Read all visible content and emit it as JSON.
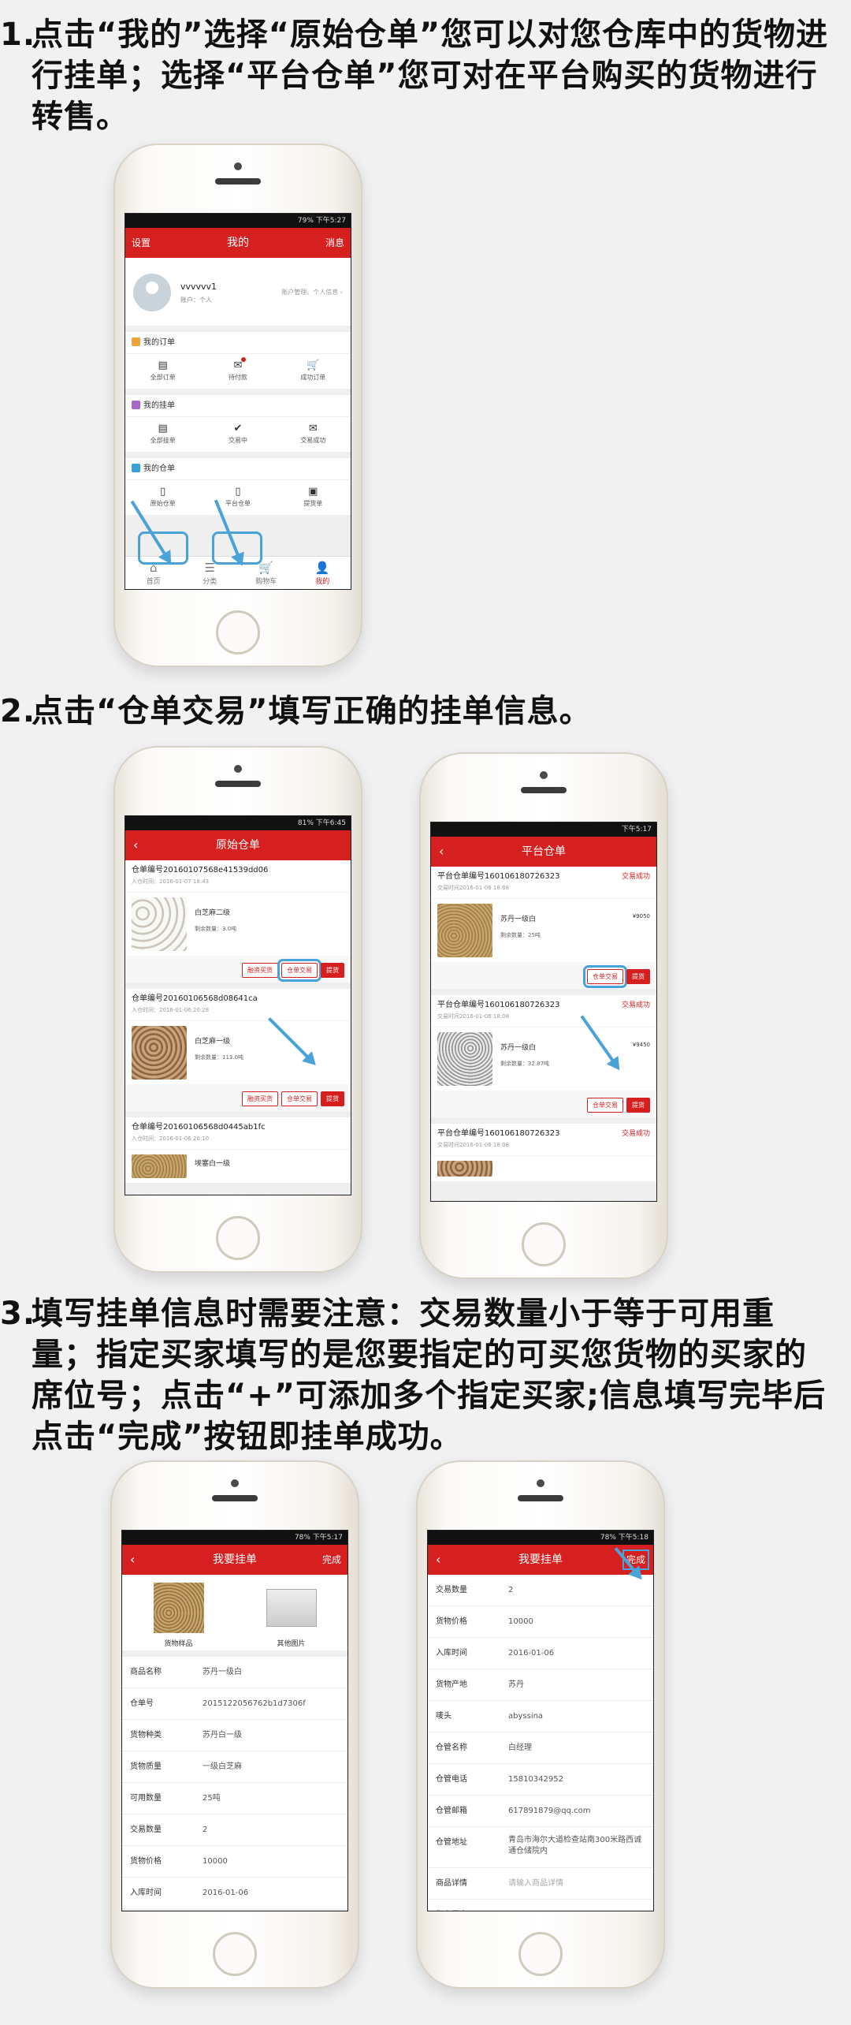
{
  "steps": {
    "s1": {
      "num": "1.",
      "text": "点击“我的”选择“原始仓单”您可以对您仓库中的货物进行挂单；选择“平台仓单”您可对在平台购买的货物进行转售。"
    },
    "s2": {
      "num": "2.",
      "text": "点击“仓单交易”填写正确的挂单信息。"
    },
    "s3": {
      "num": "3.",
      "text": "填写挂单信息时需要注意：交易数量小于等于可用重量；指定买家填写的是您要指定的可买您货物的买家的席位号；点击“+”可添加多个指定买家;信息填写完毕后点击“完成”按钮即挂单成功。"
    }
  },
  "phone1": {
    "status": "79% 下午5:27",
    "nav": {
      "left": "设置",
      "title": "我的",
      "right": "消息"
    },
    "profile": {
      "name": "vvvvvv1",
      "account": "账户：个人",
      "link": "账户管理、个人信息 ›"
    },
    "orders": {
      "title": "我的订单",
      "items": [
        {
          "icon": "▤",
          "label": "全部订单"
        },
        {
          "icon": "✉",
          "label": "待付款"
        },
        {
          "icon": "🛒",
          "label": "成功订单"
        }
      ]
    },
    "listings": {
      "title": "我的挂单",
      "items": [
        {
          "icon": "▤",
          "label": "全部挂单"
        },
        {
          "icon": "✔",
          "label": "交易中"
        },
        {
          "icon": "✉",
          "label": "交易成功"
        }
      ]
    },
    "warehouse": {
      "title": "我的仓单",
      "items": [
        {
          "icon": "▯",
          "label": "原始仓单"
        },
        {
          "icon": "▯",
          "label": "平台仓单"
        },
        {
          "icon": "▣",
          "label": "提货单"
        }
      ]
    },
    "tabs": [
      {
        "icon": "⌂",
        "label": "首页"
      },
      {
        "icon": "☰",
        "label": "分类"
      },
      {
        "icon": "🛒",
        "label": "购物车"
      },
      {
        "icon": "👤",
        "label": "我的"
      }
    ]
  },
  "phone2": {
    "status": "81% 下午6:45",
    "title": "原始仓单",
    "orders": [
      {
        "no": "仓单编号20160107568e41539dd06",
        "time": "入仓时间：2016-01-07 18:43",
        "name": "白芝麻二级",
        "qty": "剩余数量：3.0吨",
        "buttons": [
          "融资买货",
          "仓单交易",
          "提货"
        ]
      },
      {
        "no": "仓单编号20160106568d08641ca",
        "time": "入仓时间：2016-01-06 20:28",
        "name": "白芝麻一级",
        "qty": "剩余数量：113.0吨",
        "buttons": [
          "融资买货",
          "仓单交易",
          "提货"
        ]
      },
      {
        "no": "仓单编号20160106568d0445ab1fc",
        "time": "入仓时间：2016-01-06 20:10",
        "name": "埃塞白一级",
        "qty": "",
        "buttons": []
      }
    ]
  },
  "phone3": {
    "status": "下午5:17",
    "title": "平台仓单",
    "orders": [
      {
        "no": "平台仓单编号160106180726323",
        "time": "交易时间2016-01-06 18:08",
        "status": "交易成功",
        "name": "苏丹一级白",
        "qty": "剩余数量：25吨",
        "price": "¥9050",
        "buttons": [
          "仓单交易",
          "提货"
        ]
      },
      {
        "no": "平台仓单编号160106180726323",
        "time": "交易时间2016-01-06 18:08",
        "status": "交易成功",
        "name": "苏丹一级白",
        "qty": "剩余数量：32.87吨",
        "price": "¥9450",
        "buttons": [
          "仓单交易",
          "提货"
        ]
      },
      {
        "no": "平台仓单编号160106180726323",
        "time": "交易时间2016-01-06 18:08",
        "status": "交易成功",
        "name": "",
        "qty": "",
        "price": "",
        "buttons": []
      }
    ]
  },
  "phone4": {
    "status": "78% 下午5:17",
    "title": "我要挂单",
    "done": "完成",
    "images": {
      "sample": "货物样品",
      "other": "其他图片"
    },
    "rows": [
      {
        "k": "商品名称",
        "v": "苏丹一级白"
      },
      {
        "k": "仓单号",
        "v": "2015122056762b1d7306f"
      },
      {
        "k": "货物种类",
        "v": "苏丹白一级"
      },
      {
        "k": "货物质量",
        "v": "一级白芝麻"
      },
      {
        "k": "可用数量",
        "v": "25吨"
      },
      {
        "k": "交易数量",
        "v": "2"
      },
      {
        "k": "货物价格",
        "v": "10000"
      },
      {
        "k": "入库时间",
        "v": "2016-01-06"
      }
    ]
  },
  "phone5": {
    "status": "78% 下午5:18",
    "title": "我要挂单",
    "done": "完成",
    "rows": [
      {
        "k": "交易数量",
        "v": "2"
      },
      {
        "k": "货物价格",
        "v": "10000"
      },
      {
        "k": "入库时间",
        "v": "2016-01-06"
      },
      {
        "k": "货物产地",
        "v": "苏丹"
      },
      {
        "k": "唛头",
        "v": "abyssina"
      },
      {
        "k": "仓管名称",
        "v": "白经理"
      },
      {
        "k": "仓管电话",
        "v": "15810342952"
      },
      {
        "k": "仓管邮箱",
        "v": "617891879@qq.com"
      },
      {
        "k": "仓管地址",
        "v": "青岛市海尔大道检查站南300米路西诚通仓储院内"
      },
      {
        "k": "商品详情",
        "v": "请输入商品详情"
      },
      {
        "k": "指定买家",
        "v": ""
      }
    ],
    "plus": "+"
  }
}
